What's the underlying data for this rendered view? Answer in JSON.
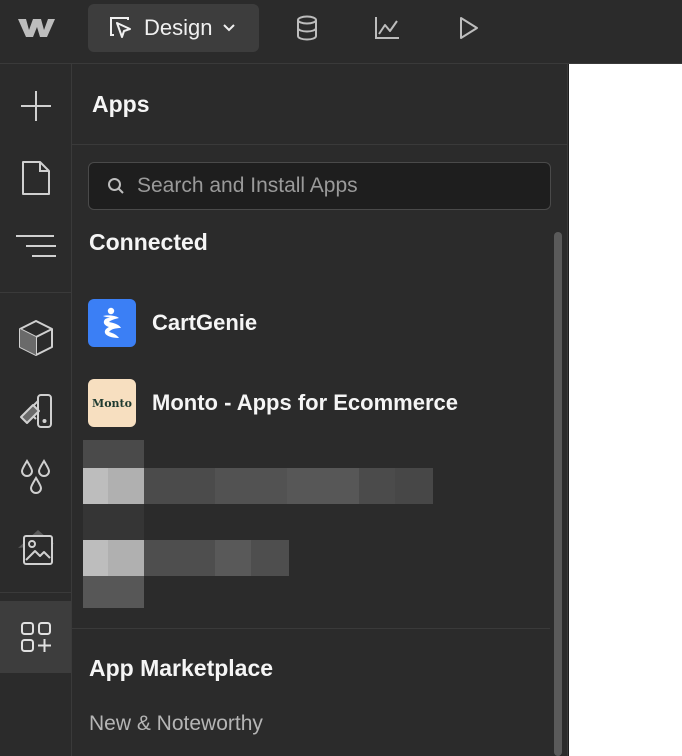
{
  "topbar": {
    "mode_label": "Design",
    "tools": [
      "cms-icon",
      "analyze-icon",
      "preview-icon"
    ]
  },
  "rail": {
    "items": [
      "add-icon",
      "pages-icon",
      "navigator-icon",
      "components-icon",
      "style-selectors-icon",
      "variables-icon",
      "assets-icon",
      "apps-icon"
    ],
    "active": "apps-icon"
  },
  "panel": {
    "title": "Apps",
    "search_placeholder": "Search and Install Apps",
    "connected_title": "Connected",
    "apps": [
      {
        "name": "CartGenie",
        "icon": "cartgenie-logo",
        "icon_bg": "#3b7ff5"
      },
      {
        "name": "Monto - Apps for Ecommerce",
        "icon": "monto-logo",
        "icon_text": "Monto",
        "icon_bg": "#f7dfc0"
      }
    ],
    "marketplace_title": "App Marketplace",
    "marketplace_section": "New & Noteworthy"
  },
  "colors": {
    "background": "#2b2b2b",
    "active_item": "#3d3d3d",
    "canvas": "#ffffff"
  }
}
